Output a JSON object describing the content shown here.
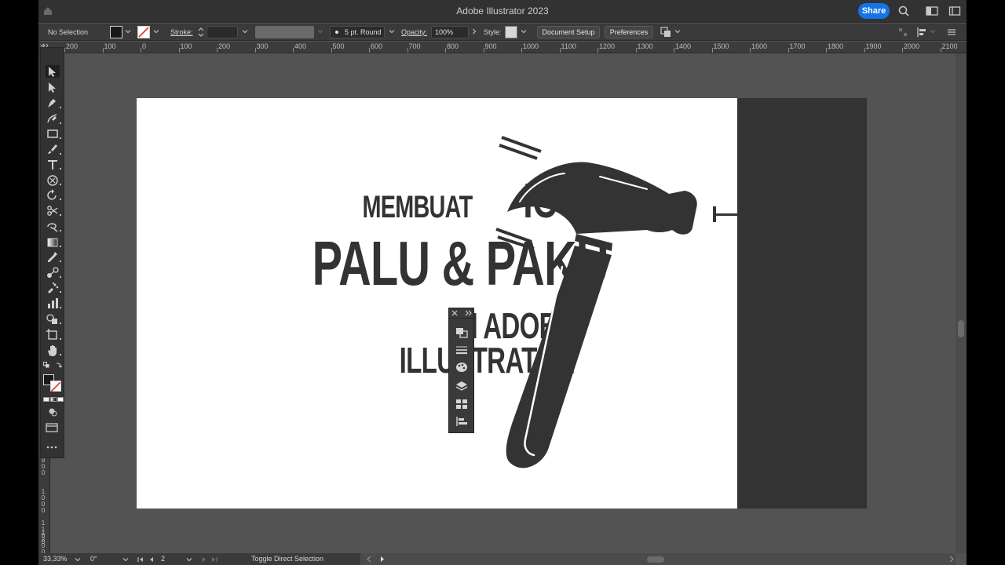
{
  "window": {
    "title": "Adobe Illustrator 2023",
    "share_label": "Share"
  },
  "control_bar": {
    "selection_label": "No Selection",
    "stroke_label": "Stroke:",
    "stroke_weight": "",
    "brush_label": "5 pt. Round",
    "opacity_label": "Opacity:",
    "opacity_value": "100%",
    "style_label": "Style:",
    "document_setup_label": "Document Setup",
    "preferences_label": "Preferences"
  },
  "ruler": {
    "top_labels": [
      "200",
      "100",
      "0",
      "100",
      "200",
      "300",
      "400",
      "500",
      "600",
      "700",
      "800",
      "900",
      "1000",
      "1100",
      "1200",
      "1300",
      "1400",
      "1500",
      "1600",
      "1700",
      "1800",
      "1900",
      "2000",
      "2100"
    ],
    "left_labels": [
      "900",
      "1000",
      "1100",
      "1200"
    ]
  },
  "tools": [
    {
      "name": "selection-tool-icon",
      "label": "Selection"
    },
    {
      "name": "direct-selection-tool-icon",
      "label": "Direct Selection"
    },
    {
      "name": "pen-tool-icon",
      "label": "Pen"
    },
    {
      "name": "curvature-tool-icon",
      "label": "Curvature"
    },
    {
      "name": "rectangle-tool-icon",
      "label": "Rectangle"
    },
    {
      "name": "paintbrush-tool-icon",
      "label": "Paintbrush"
    },
    {
      "name": "type-tool-icon",
      "label": "Type"
    },
    {
      "name": "shaper-tool-icon",
      "label": "Shaper"
    },
    {
      "name": "rotate-tool-icon",
      "label": "Rotate"
    },
    {
      "name": "scissors-tool-icon",
      "label": "Scissors"
    },
    {
      "name": "warp-tool-icon",
      "label": "Warp"
    },
    {
      "name": "gradient-tool-icon",
      "label": "Gradient"
    },
    {
      "name": "eyedropper-tool-icon",
      "label": "Eyedropper"
    },
    {
      "name": "blend-tool-icon",
      "label": "Blend"
    },
    {
      "name": "symbol-sprayer-tool-icon",
      "label": "Symbol Sprayer"
    },
    {
      "name": "graph-tool-icon",
      "label": "Graph"
    },
    {
      "name": "shape-builder-tool-icon",
      "label": "Shape Builder"
    },
    {
      "name": "artboard-tool-icon",
      "label": "Artboard"
    },
    {
      "name": "hand-tool-icon",
      "label": "Hand"
    }
  ],
  "artwork": {
    "line1_a": "MEMBUAT",
    "line1_b": "ICON",
    "line2": "PALU & PAKU",
    "line3": "DI ADOBE",
    "line4": "ILLUSTRATOR",
    "color": "#333333"
  },
  "status_bar": {
    "zoom": "33,33%",
    "rotation": "0°",
    "artboard_number": "2",
    "status_text": "Toggle Direct Selection"
  },
  "colors": {
    "accent": "#1473e6",
    "panel_bg": "#323232",
    "canvas_bg": "#535353"
  }
}
